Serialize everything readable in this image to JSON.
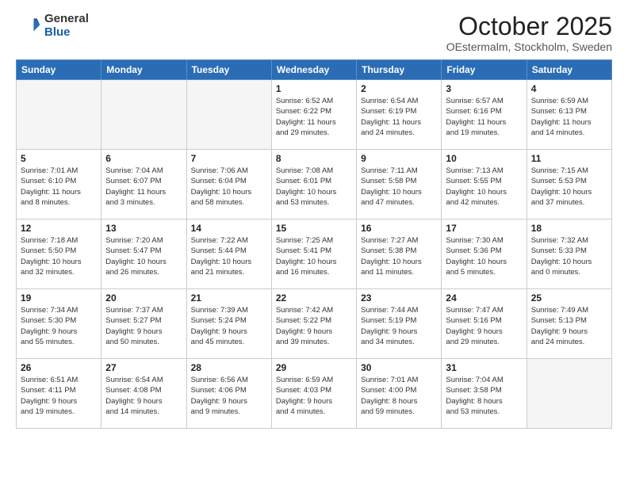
{
  "header": {
    "logo_general": "General",
    "logo_blue": "Blue",
    "month_title": "October 2025",
    "location": "OEstermalm, Stockholm, Sweden"
  },
  "days_of_week": [
    "Sunday",
    "Monday",
    "Tuesday",
    "Wednesday",
    "Thursday",
    "Friday",
    "Saturday"
  ],
  "weeks": [
    [
      {
        "day": "",
        "info": ""
      },
      {
        "day": "",
        "info": ""
      },
      {
        "day": "",
        "info": ""
      },
      {
        "day": "1",
        "info": "Sunrise: 6:52 AM\nSunset: 6:22 PM\nDaylight: 11 hours\nand 29 minutes."
      },
      {
        "day": "2",
        "info": "Sunrise: 6:54 AM\nSunset: 6:19 PM\nDaylight: 11 hours\nand 24 minutes."
      },
      {
        "day": "3",
        "info": "Sunrise: 6:57 AM\nSunset: 6:16 PM\nDaylight: 11 hours\nand 19 minutes."
      },
      {
        "day": "4",
        "info": "Sunrise: 6:59 AM\nSunset: 6:13 PM\nDaylight: 11 hours\nand 14 minutes."
      }
    ],
    [
      {
        "day": "5",
        "info": "Sunrise: 7:01 AM\nSunset: 6:10 PM\nDaylight: 11 hours\nand 8 minutes."
      },
      {
        "day": "6",
        "info": "Sunrise: 7:04 AM\nSunset: 6:07 PM\nDaylight: 11 hours\nand 3 minutes."
      },
      {
        "day": "7",
        "info": "Sunrise: 7:06 AM\nSunset: 6:04 PM\nDaylight: 10 hours\nand 58 minutes."
      },
      {
        "day": "8",
        "info": "Sunrise: 7:08 AM\nSunset: 6:01 PM\nDaylight: 10 hours\nand 53 minutes."
      },
      {
        "day": "9",
        "info": "Sunrise: 7:11 AM\nSunset: 5:58 PM\nDaylight: 10 hours\nand 47 minutes."
      },
      {
        "day": "10",
        "info": "Sunrise: 7:13 AM\nSunset: 5:55 PM\nDaylight: 10 hours\nand 42 minutes."
      },
      {
        "day": "11",
        "info": "Sunrise: 7:15 AM\nSunset: 5:53 PM\nDaylight: 10 hours\nand 37 minutes."
      }
    ],
    [
      {
        "day": "12",
        "info": "Sunrise: 7:18 AM\nSunset: 5:50 PM\nDaylight: 10 hours\nand 32 minutes."
      },
      {
        "day": "13",
        "info": "Sunrise: 7:20 AM\nSunset: 5:47 PM\nDaylight: 10 hours\nand 26 minutes."
      },
      {
        "day": "14",
        "info": "Sunrise: 7:22 AM\nSunset: 5:44 PM\nDaylight: 10 hours\nand 21 minutes."
      },
      {
        "day": "15",
        "info": "Sunrise: 7:25 AM\nSunset: 5:41 PM\nDaylight: 10 hours\nand 16 minutes."
      },
      {
        "day": "16",
        "info": "Sunrise: 7:27 AM\nSunset: 5:38 PM\nDaylight: 10 hours\nand 11 minutes."
      },
      {
        "day": "17",
        "info": "Sunrise: 7:30 AM\nSunset: 5:36 PM\nDaylight: 10 hours\nand 5 minutes."
      },
      {
        "day": "18",
        "info": "Sunrise: 7:32 AM\nSunset: 5:33 PM\nDaylight: 10 hours\nand 0 minutes."
      }
    ],
    [
      {
        "day": "19",
        "info": "Sunrise: 7:34 AM\nSunset: 5:30 PM\nDaylight: 9 hours\nand 55 minutes."
      },
      {
        "day": "20",
        "info": "Sunrise: 7:37 AM\nSunset: 5:27 PM\nDaylight: 9 hours\nand 50 minutes."
      },
      {
        "day": "21",
        "info": "Sunrise: 7:39 AM\nSunset: 5:24 PM\nDaylight: 9 hours\nand 45 minutes."
      },
      {
        "day": "22",
        "info": "Sunrise: 7:42 AM\nSunset: 5:22 PM\nDaylight: 9 hours\nand 39 minutes."
      },
      {
        "day": "23",
        "info": "Sunrise: 7:44 AM\nSunset: 5:19 PM\nDaylight: 9 hours\nand 34 minutes."
      },
      {
        "day": "24",
        "info": "Sunrise: 7:47 AM\nSunset: 5:16 PM\nDaylight: 9 hours\nand 29 minutes."
      },
      {
        "day": "25",
        "info": "Sunrise: 7:49 AM\nSunset: 5:13 PM\nDaylight: 9 hours\nand 24 minutes."
      }
    ],
    [
      {
        "day": "26",
        "info": "Sunrise: 6:51 AM\nSunset: 4:11 PM\nDaylight: 9 hours\nand 19 minutes."
      },
      {
        "day": "27",
        "info": "Sunrise: 6:54 AM\nSunset: 4:08 PM\nDaylight: 9 hours\nand 14 minutes."
      },
      {
        "day": "28",
        "info": "Sunrise: 6:56 AM\nSunset: 4:06 PM\nDaylight: 9 hours\nand 9 minutes."
      },
      {
        "day": "29",
        "info": "Sunrise: 6:59 AM\nSunset: 4:03 PM\nDaylight: 9 hours\nand 4 minutes."
      },
      {
        "day": "30",
        "info": "Sunrise: 7:01 AM\nSunset: 4:00 PM\nDaylight: 8 hours\nand 59 minutes."
      },
      {
        "day": "31",
        "info": "Sunrise: 7:04 AM\nSunset: 3:58 PM\nDaylight: 8 hours\nand 53 minutes."
      },
      {
        "day": "",
        "info": ""
      }
    ]
  ]
}
